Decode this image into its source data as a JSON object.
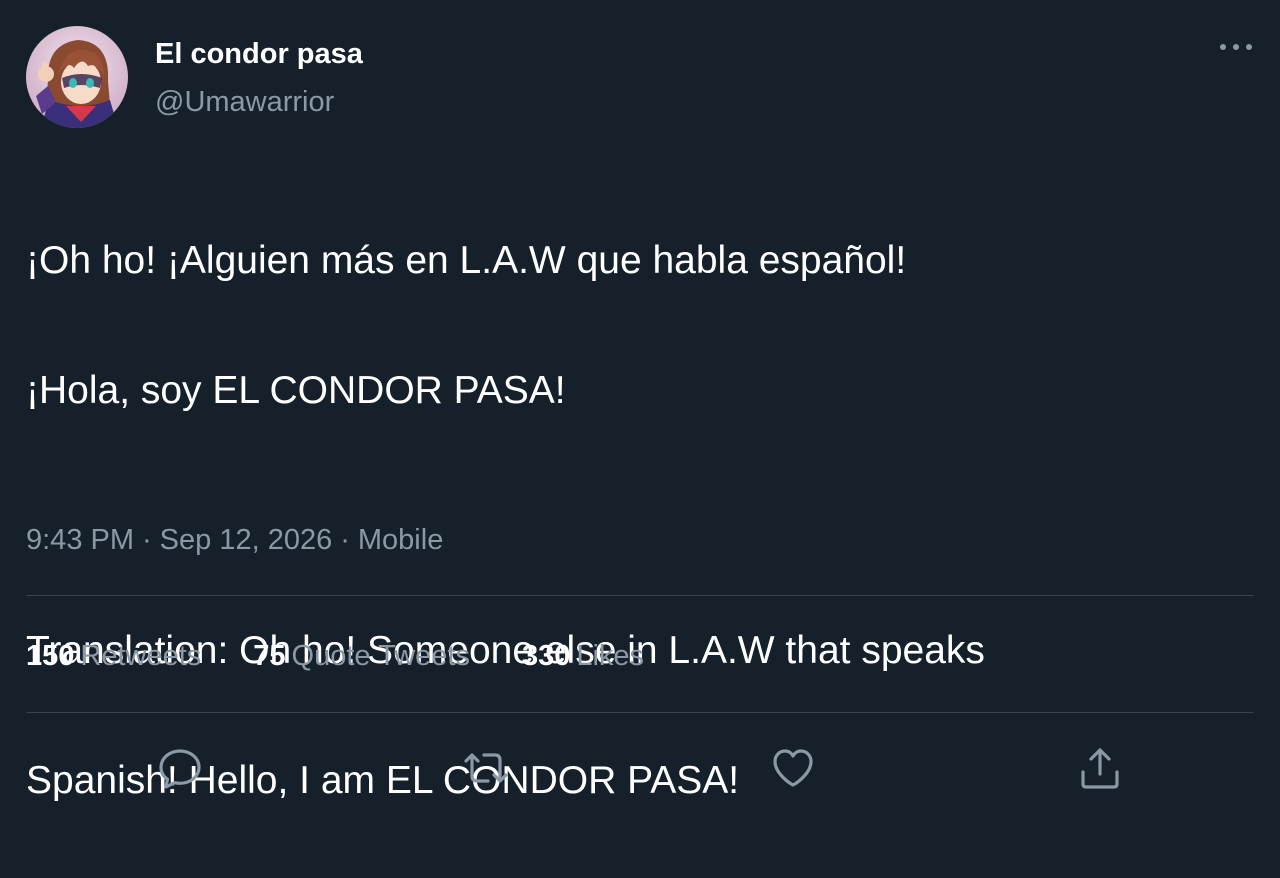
{
  "author": {
    "display_name": "El condor pasa",
    "handle": "@Umawarrior"
  },
  "tweet": {
    "line1": "¡Oh ho! ¡Alguien más en L.A.W que habla español!",
    "line2": "¡Hola, soy EL CONDOR PASA!",
    "translation_line1": "Translation: Oh ho! Someone else in L.A.W that speaks",
    "translation_line2": "Spanish! Hello, I am EL CONDOR PASA!"
  },
  "meta": {
    "time": "9:43 PM",
    "separator": "·",
    "date": "Sep 12, 2026",
    "source": "Mobile"
  },
  "stats": {
    "retweets_count": "150",
    "retweets_label": "Retweets",
    "quotes_count": "75",
    "quotes_label": "Quote Tweets",
    "likes_count": "330",
    "likes_label": "Likes"
  },
  "icons": {
    "more": "more-horizontal-icon",
    "reply": "reply-icon",
    "retweet": "retweet-icon",
    "like": "heart-icon",
    "share": "share-icon"
  },
  "colors": {
    "background": "#15202b",
    "text_primary": "#ffffff",
    "text_secondary": "#8b98a5",
    "divider": "#38444d"
  }
}
